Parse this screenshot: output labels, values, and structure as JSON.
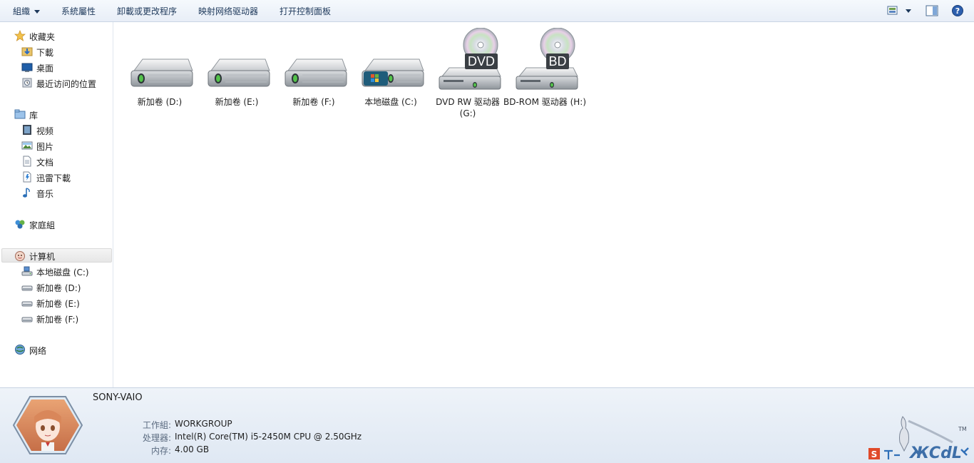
{
  "toolbar": {
    "organize": "組織",
    "system_properties": "系統屬性",
    "uninstall": "卸載或更改程序",
    "map_drive": "映射网络驱动器",
    "control_panel": "打开控制面板"
  },
  "sidebar": {
    "favorites": "收藏夹",
    "downloads": "下載",
    "desktop": "桌面",
    "recent": "最近访问的位置",
    "libraries": "库",
    "videos": "视频",
    "pictures": "图片",
    "documents": "文档",
    "thunder": "迅雷下載",
    "music": "音乐",
    "homegroup": "家庭組",
    "computer": "计算机",
    "drive_c": "本地磁盘 (C:)",
    "drive_d": "新加卷 (D:)",
    "drive_e": "新加卷 (E:)",
    "drive_f": "新加卷 (F:)",
    "network": "网络"
  },
  "drives": [
    {
      "name": "新加卷 (D:)",
      "icon": "hard-drive-icon"
    },
    {
      "name": "新加卷 (E:)",
      "icon": "hard-drive-icon"
    },
    {
      "name": "新加卷 (F:)",
      "icon": "hard-drive-icon"
    },
    {
      "name": "本地磁盘 (C:)",
      "icon": "system-drive-icon"
    },
    {
      "name": "DVD RW 驱动器 (G:)",
      "icon": "dvd-drive-icon",
      "badge": "DVD"
    },
    {
      "name": "BD-ROM 驱动器 (H:)",
      "icon": "bd-drive-icon",
      "badge": "BD"
    }
  ],
  "details": {
    "computer_name": "SONY-VAIO",
    "workgroup_label": "工作組:",
    "workgroup": "WORKGROUP",
    "cpu_label": "处理器:",
    "cpu": "Intel(R) Core(TM) i5-2450M CPU @ 2.50GHz",
    "memory_label": "内存:",
    "memory": "4.00 GB"
  },
  "colors": {
    "toolbar_text": "#1e395b",
    "pane_bg": "#e6edf6"
  }
}
